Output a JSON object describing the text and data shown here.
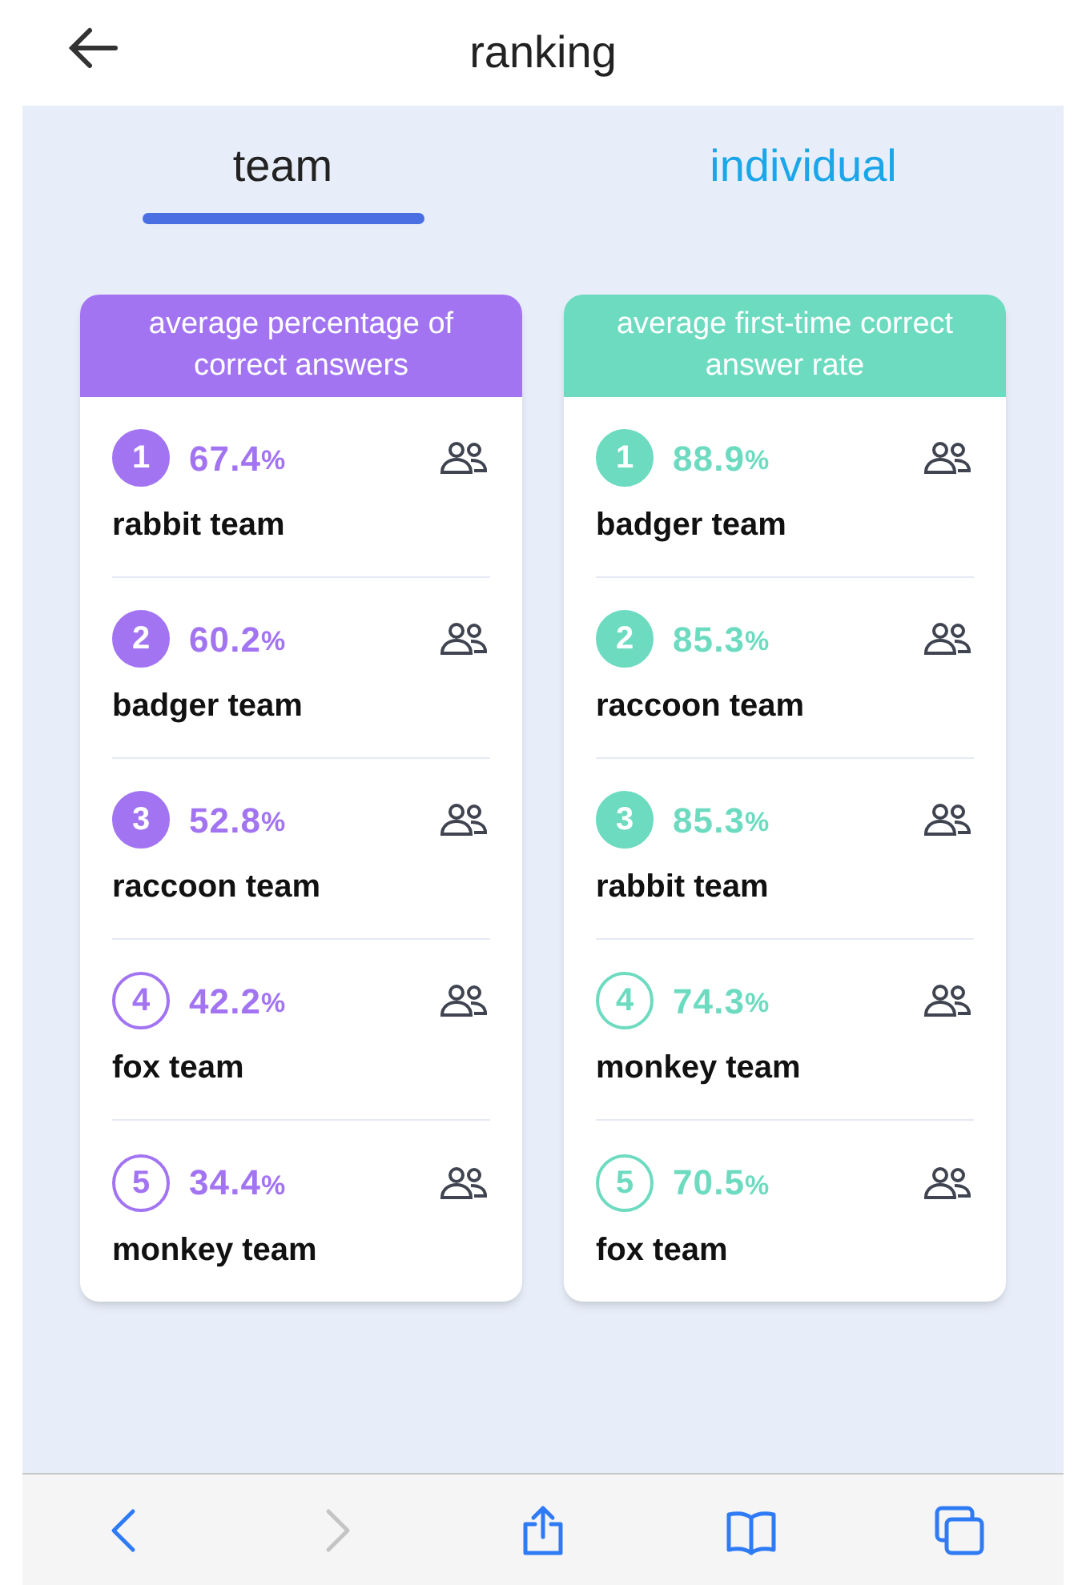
{
  "header": {
    "title": "ranking"
  },
  "tabs": [
    {
      "label": "team",
      "selected": true
    },
    {
      "label": "individual",
      "selected": false
    }
  ],
  "boards": [
    {
      "title": "average percentage of correct answers",
      "color": "#a274f2",
      "rows": [
        {
          "rank": "1",
          "value": "67.4",
          "unit": "%",
          "team": "rabbit team",
          "highlighted": true
        },
        {
          "rank": "2",
          "value": "60.2",
          "unit": "%",
          "team": "badger team",
          "highlighted": true
        },
        {
          "rank": "3",
          "value": "52.8",
          "unit": "%",
          "team": "raccoon team",
          "highlighted": true
        },
        {
          "rank": "4",
          "value": "42.2",
          "unit": "%",
          "team": "fox team",
          "highlighted": false
        },
        {
          "rank": "5",
          "value": "34.4",
          "unit": "%",
          "team": "monkey team",
          "highlighted": false
        }
      ]
    },
    {
      "title": "average first-time correct answer rate",
      "color": "#6ddbc0",
      "rows": [
        {
          "rank": "1",
          "value": "88.9",
          "unit": "%",
          "team": "badger team",
          "highlighted": true
        },
        {
          "rank": "2",
          "value": "85.3",
          "unit": "%",
          "team": "raccoon team",
          "highlighted": true
        },
        {
          "rank": "3",
          "value": "85.3",
          "unit": "%",
          "team": "rabbit team",
          "highlighted": true
        },
        {
          "rank": "4",
          "value": "74.3",
          "unit": "%",
          "team": "monkey team",
          "highlighted": false
        },
        {
          "rank": "5",
          "value": "70.5",
          "unit": "%",
          "team": "fox team",
          "highlighted": false
        }
      ]
    }
  ],
  "toolbar": [
    {
      "kind": "back",
      "disabled": false
    },
    {
      "kind": "forward",
      "disabled": true
    },
    {
      "kind": "share",
      "disabled": false
    },
    {
      "kind": "bookmarks",
      "disabled": false
    },
    {
      "kind": "tabs",
      "disabled": false
    }
  ]
}
